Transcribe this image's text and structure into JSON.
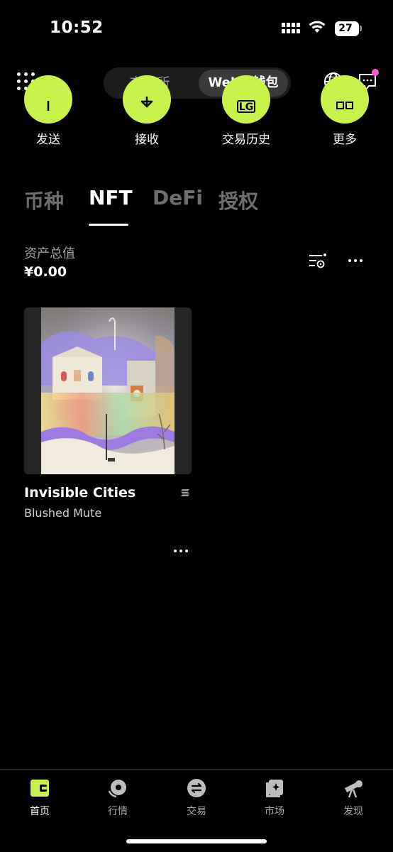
{
  "status_bar": {
    "time": "10:52",
    "battery": "27"
  },
  "header": {
    "menu_icon": "grid-icon",
    "segments": {
      "exchange": "交易所",
      "web3": "Web3 钱包"
    },
    "globe_icon": "globe-icon",
    "message_icon": "message-icon"
  },
  "actions": [
    {
      "label": "发送",
      "icon": "send-icon"
    },
    {
      "label": "接收",
      "icon": "receive-icon"
    },
    {
      "label": "交易历史",
      "icon": "history-icon",
      "glyph": "LG"
    },
    {
      "label": "更多",
      "icon": "more-icon"
    }
  ],
  "tabs": [
    "币种",
    "NFT",
    "DeFi",
    "授权"
  ],
  "active_tab": "NFT",
  "total": {
    "label": "资产总值",
    "value": "¥0.00"
  },
  "nft": {
    "title": "Invisible Cities",
    "subtitle": "Blushed Mute",
    "chain_icon": "solana-icon"
  },
  "bottom_nav": [
    {
      "label": "首页",
      "icon": "wallet-icon",
      "active": true
    },
    {
      "label": "行情",
      "icon": "market-icon",
      "active": false
    },
    {
      "label": "交易",
      "icon": "swap-icon",
      "active": false
    },
    {
      "label": "市场",
      "icon": "nft-market-icon",
      "active": false
    },
    {
      "label": "发现",
      "icon": "telescope-icon",
      "active": false
    }
  ],
  "colors": {
    "accent": "#c7f24a",
    "background": "#000000",
    "badge": "#ff5fd2"
  }
}
